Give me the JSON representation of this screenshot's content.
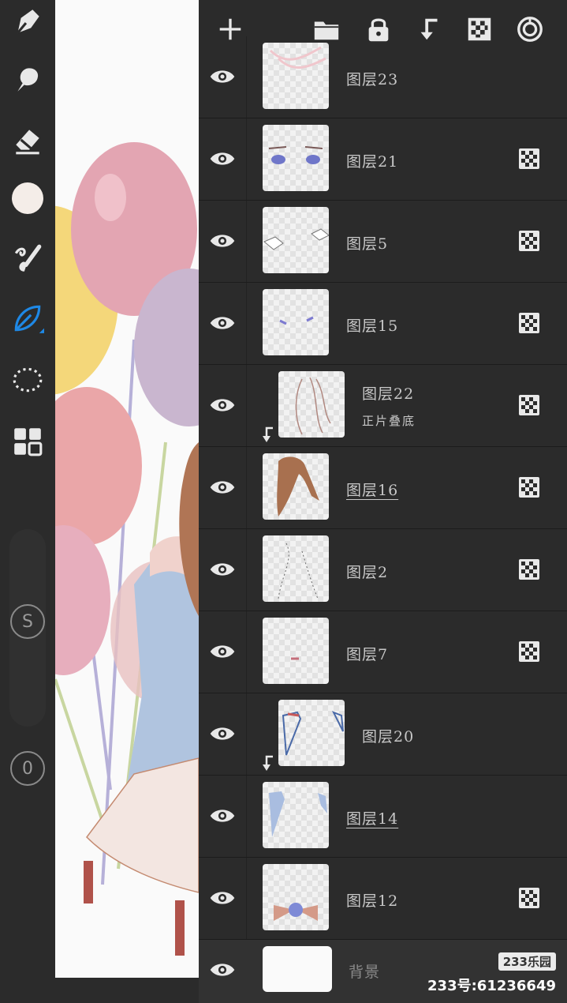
{
  "toolbar": {
    "tools": [
      {
        "name": "pen-tool-icon"
      },
      {
        "name": "smudge-tool-icon"
      },
      {
        "name": "eraser-icon"
      },
      {
        "name": "color-swatch",
        "color": "#f4ede8"
      },
      {
        "name": "brush-library-icon"
      },
      {
        "name": "leaf-brush-icon",
        "active": true
      },
      {
        "name": "lasso-selection-icon"
      },
      {
        "name": "layers-grid-icon"
      }
    ],
    "size_button_label": "S",
    "opacity_button_label": "0"
  },
  "header": {
    "buttons": [
      "add-layer-icon",
      "folder-icon",
      "lock-icon",
      "clip-layer-icon",
      "checker-icon",
      "target-icon"
    ]
  },
  "layers": [
    {
      "name": "图层23",
      "underline": false,
      "clipped": false,
      "blend": false,
      "sub": ""
    },
    {
      "name": "图层21",
      "underline": false,
      "clipped": false,
      "blend": true,
      "sub": ""
    },
    {
      "name": "图层5",
      "underline": false,
      "clipped": false,
      "blend": true,
      "sub": ""
    },
    {
      "name": "图层15",
      "underline": false,
      "clipped": false,
      "blend": true,
      "sub": ""
    },
    {
      "name": "图层22",
      "underline": false,
      "clipped": true,
      "blend": true,
      "sub": "正片叠底"
    },
    {
      "name": "图层16",
      "underline": true,
      "clipped": false,
      "blend": true,
      "sub": ""
    },
    {
      "name": "图层2",
      "underline": false,
      "clipped": false,
      "blend": true,
      "sub": ""
    },
    {
      "name": "图层7",
      "underline": false,
      "clipped": false,
      "blend": true,
      "sub": ""
    },
    {
      "name": "图层20",
      "underline": false,
      "clipped": true,
      "blend": false,
      "sub": ""
    },
    {
      "name": "图层14",
      "underline": true,
      "clipped": false,
      "blend": false,
      "sub": ""
    },
    {
      "name": "图层12",
      "underline": false,
      "clipped": false,
      "blend": true,
      "sub": ""
    },
    {
      "name": "背景",
      "underline": false,
      "clipped": false,
      "blend": false,
      "sub": ""
    }
  ],
  "watermark": {
    "logo": "233乐园",
    "id_text": "233号:61236649"
  },
  "colors": {
    "panel_bg": "#2b2b2b",
    "accent": "#1e88e5"
  }
}
